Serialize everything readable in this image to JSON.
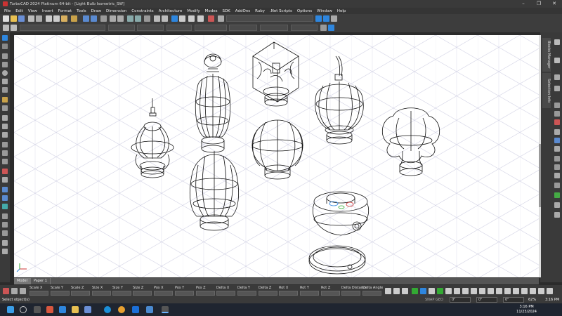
{
  "window": {
    "title": "TurboCAD 2024 Platinum 64-bit - [Light Bulb Isometric_SW]",
    "controls": [
      "–",
      "❐",
      "✕"
    ]
  },
  "menu": [
    "File",
    "Edit",
    "View",
    "Insert",
    "Format",
    "Tools",
    "Draw",
    "Dimension",
    "Constraints",
    "Architecture",
    "Modify",
    "Modes",
    "SDK",
    "AddOns",
    "Ruby",
    ".Net Scripts",
    "Options",
    "Window",
    "Help"
  ],
  "right_panel": {
    "tabs": [
      "Blocks Manager",
      "Selection Info"
    ]
  },
  "sheet_tabs": [
    "Model",
    "Paper 1"
  ],
  "coord_bar": {
    "labels": [
      "Scale X",
      "Scale Y",
      "Scale Z",
      "Size X",
      "Size Y",
      "Size Z",
      "Pos X",
      "Pos Y",
      "Pos Z",
      "Delta X",
      "Delta Y",
      "Delta Z",
      "Rot X",
      "Rot Y",
      "Rot Z",
      "Delta Distance",
      "Delta Angle"
    ]
  },
  "status": {
    "prompt": "Select object(s)",
    "snap": "SNAP GEO",
    "field1": "0\"",
    "field2": "0\"",
    "field3": "0\"",
    "zoom": "62%",
    "time": "3:16 PM"
  },
  "taskbar": {
    "time": "3:16 PM",
    "date": "11/23/2024"
  },
  "colors": {
    "accent": "#2e86de",
    "canvas_bg": "#ffffff",
    "grid": "#b9b9d6",
    "wire": "#111111"
  },
  "icons": [
    "windows-icon",
    "search-icon",
    "task-view-icon",
    "edge-icon",
    "turbocad-icon",
    "file-explorer-icon",
    "chrome-icon",
    "outlook-icon"
  ]
}
